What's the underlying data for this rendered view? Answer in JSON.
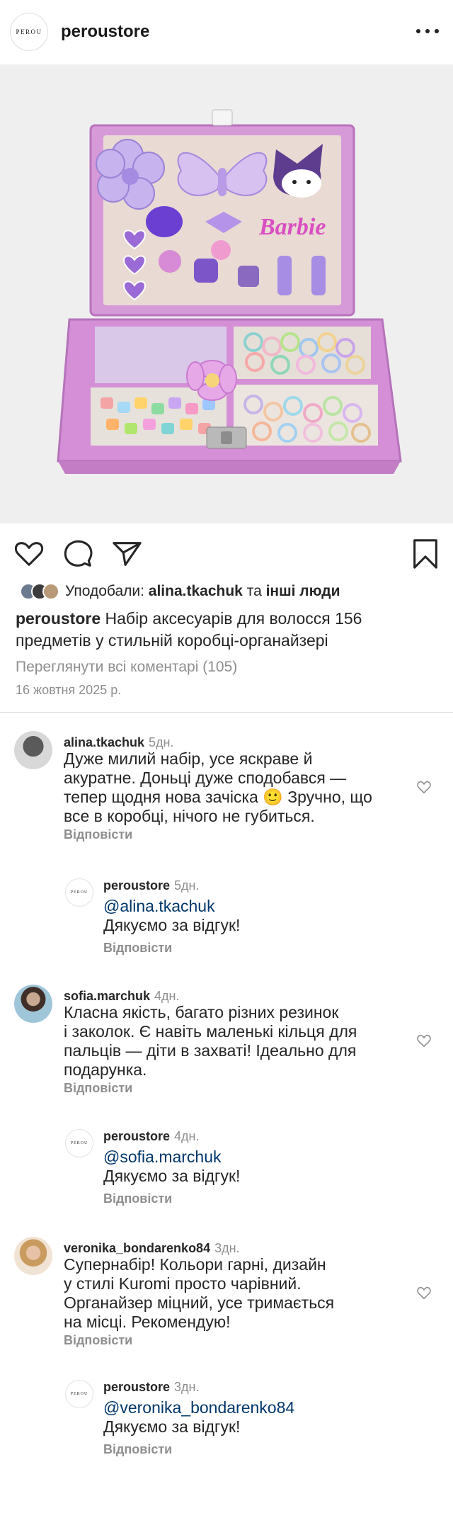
{
  "header": {
    "username": "peroustore",
    "logo_text": "PEROU",
    "more_icon": "more-horizontal-icon"
  },
  "product_image": {
    "description_icon": "product-photo",
    "box_label": "Barbie"
  },
  "actions": {
    "like_icon": "heart-icon",
    "comment_icon": "comment-icon",
    "share_icon": "send-icon",
    "save_icon": "bookmark-icon"
  },
  "likes": {
    "prefix": "Уподобали: ",
    "user": "alina.tkachuk",
    "middle": " та ",
    "others": "інші люди"
  },
  "caption": {
    "username": "peroustore",
    "text": " Набір аксесуарів для волосся 156 предметів у стильній коробці-органайзері"
  },
  "view_all_comments": "Переглянути всі коментарі (105)",
  "post_date": "16 жовтня 2025 р.",
  "comments": [
    {
      "username": "alina.tkachuk",
      "ago": "5дн.",
      "lines": [
        "Дуже милий набір, усе яскраве й",
        "акуратне. Доньці дуже сподобався —",
        "тепер щодня нова зачіска 🙂 Зручно, що",
        "все в коробці, нічого не губиться."
      ],
      "reply_label": "Відповісти",
      "reply": {
        "username": "peroustore",
        "ago": "5дн.",
        "mention": "@alina.tkachuk",
        "text": "Дякуємо за відгук!",
        "reply_label": "Відповісти"
      }
    },
    {
      "username": "sofia.marchuk",
      "ago": "4дн.",
      "lines": [
        "Класна якість, багато різних резинок",
        "і заколок. Є навіть маленькі кільця для",
        "пальців — діти в захваті! Ідеально для",
        "подарунка."
      ],
      "reply_label": "Відповісти",
      "reply": {
        "username": "peroustore",
        "ago": "4дн.",
        "mention": "@sofia.marchuk",
        "text": "Дякуємо за відгук!",
        "reply_label": "Відповісти"
      }
    },
    {
      "username": "veronika_bondarenko84",
      "ago": "3дн.",
      "lines": [
        "Супернабір! Кольори гарні, дизайн",
        "у стилі Kuromi просто чарівний.",
        "Органайзер міцний, усе тримається",
        "на місці. Рекомендую!"
      ],
      "reply_label": "Відповісти",
      "reply": {
        "username": "peroustore",
        "ago": "3дн.",
        "mention": "@veronika_bondarenko84",
        "text": "Дякуємо за відгук!",
        "reply_label": "Відповісти"
      }
    }
  ]
}
